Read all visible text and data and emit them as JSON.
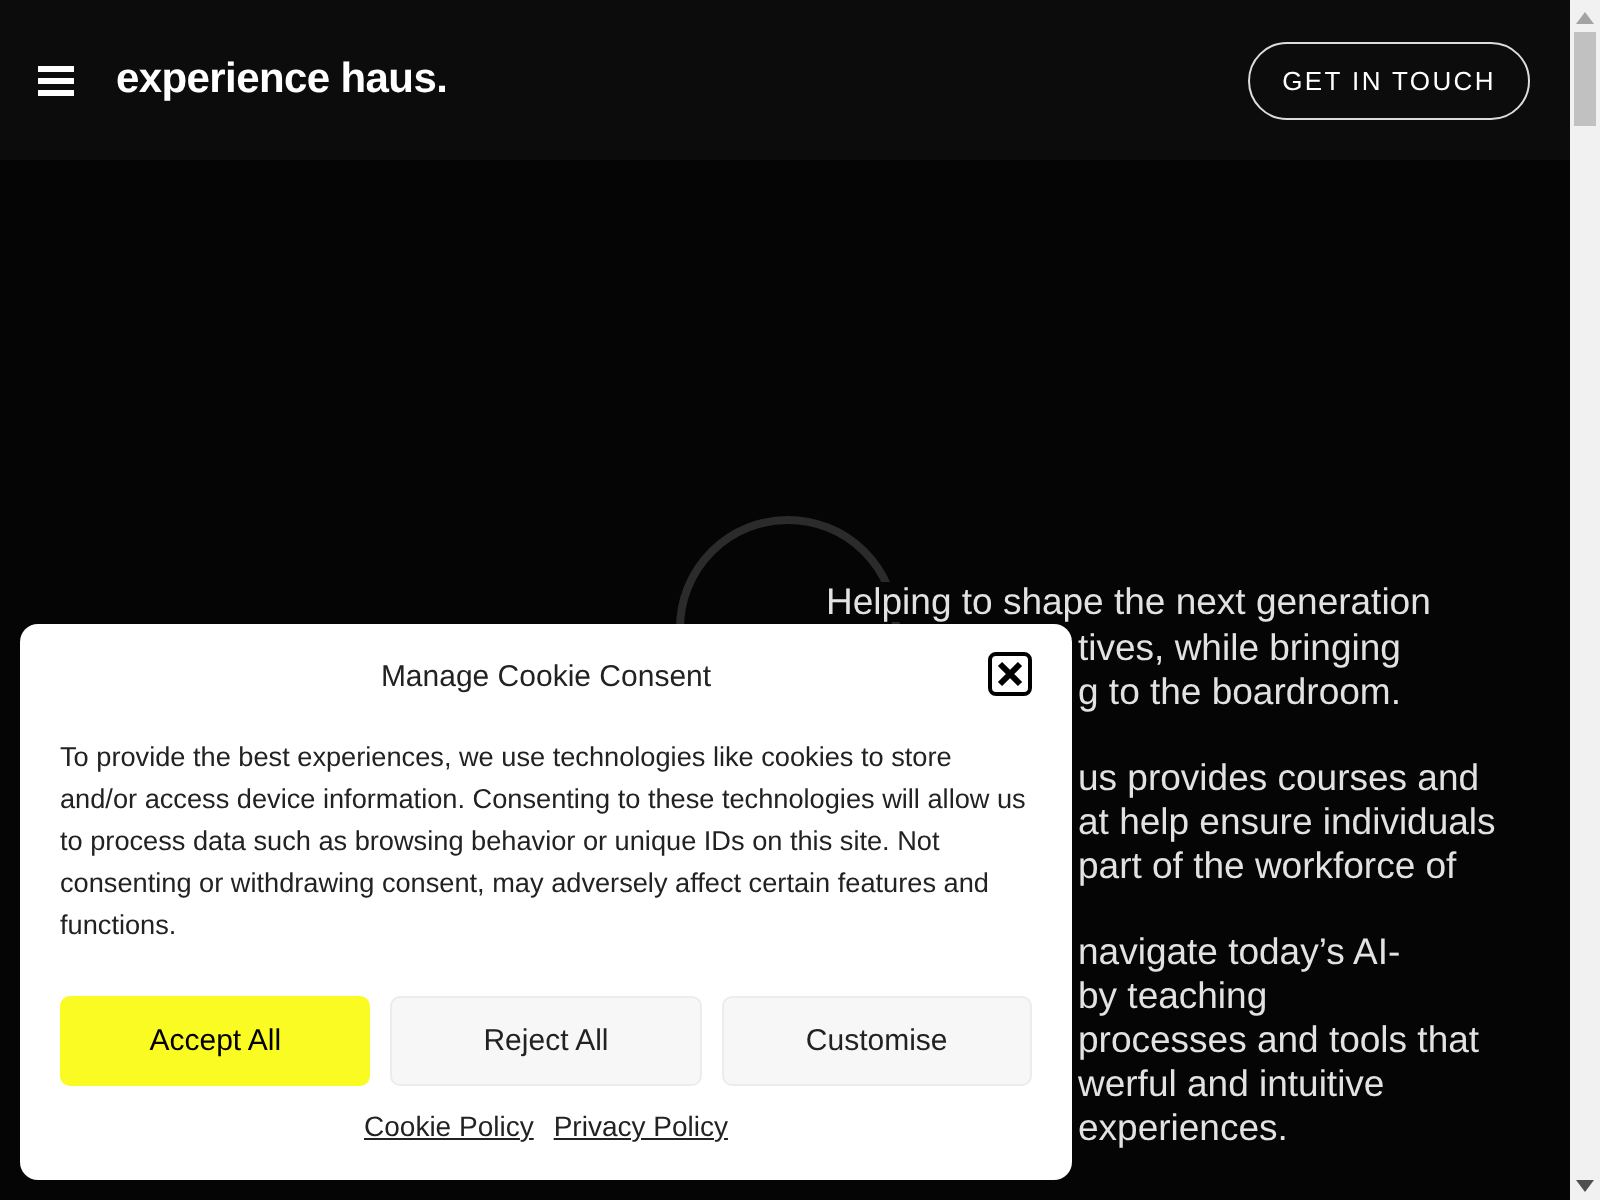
{
  "header": {
    "brand": "experience haus.",
    "cta": "GET IN TOUCH"
  },
  "hero": {
    "paragraphs": [
      [
        "Helping to shape the next generation",
        "tives, while bringing",
        "g to the boardroom."
      ],
      [
        "us provides courses and",
        "at help ensure individuals",
        "part of the workforce of"
      ],
      [
        "navigate today’s AI-",
        "by teaching",
        "processes and tools that",
        "werful and intuitive",
        "experiences."
      ]
    ]
  },
  "cookie_dialog": {
    "title": "Manage Cookie Consent",
    "body": "To provide the best experiences, we use technologies like cookies to store and/or access device information. Consenting to these technologies will allow us to process data such as browsing behavior or unique IDs on this site. Not consenting or withdrawing consent, may adversely affect certain features and functions.",
    "buttons": [
      {
        "label": "Accept All",
        "kind": "primary"
      },
      {
        "label": "Reject All",
        "kind": "secondary"
      },
      {
        "label": "Customise",
        "kind": "secondary"
      }
    ],
    "links": [
      "Cookie Policy",
      "Privacy Policy"
    ]
  }
}
